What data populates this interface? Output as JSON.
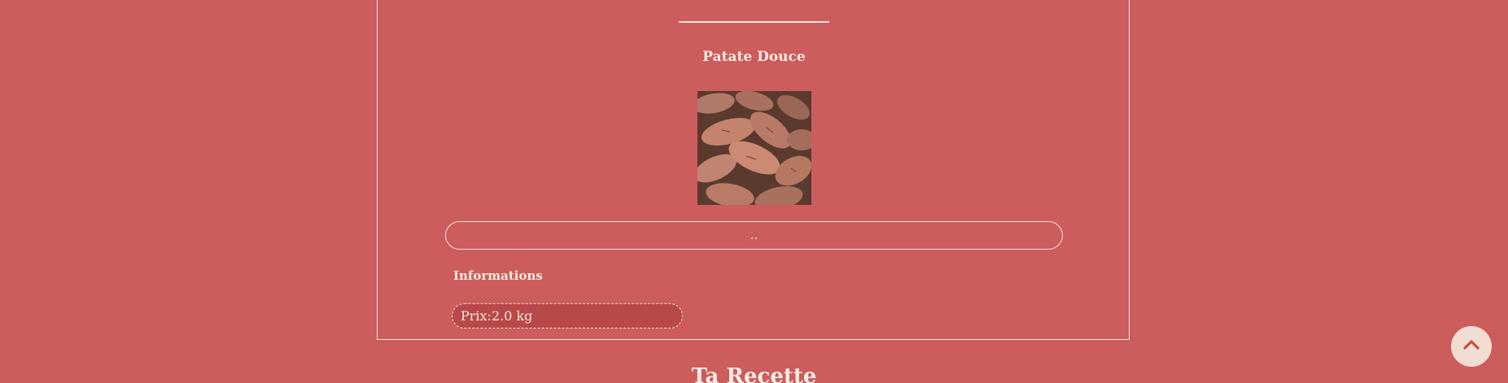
{
  "product": {
    "title": "Patate Douce",
    "image_alt": "sweet potatoes",
    "description": "..",
    "info_heading": "Informations",
    "price_text": "Prix:2.0 kg"
  },
  "recipe": {
    "title": "Ta Recette"
  },
  "controls": {
    "scroll_top_icon": "chevron-up-icon"
  },
  "colors": {
    "background": "#cd5c5c",
    "text": "#f5e6dc",
    "price_fill": "#b94848",
    "scroll_button": "#f3ddd3",
    "scroll_chevron": "#c0504f"
  }
}
